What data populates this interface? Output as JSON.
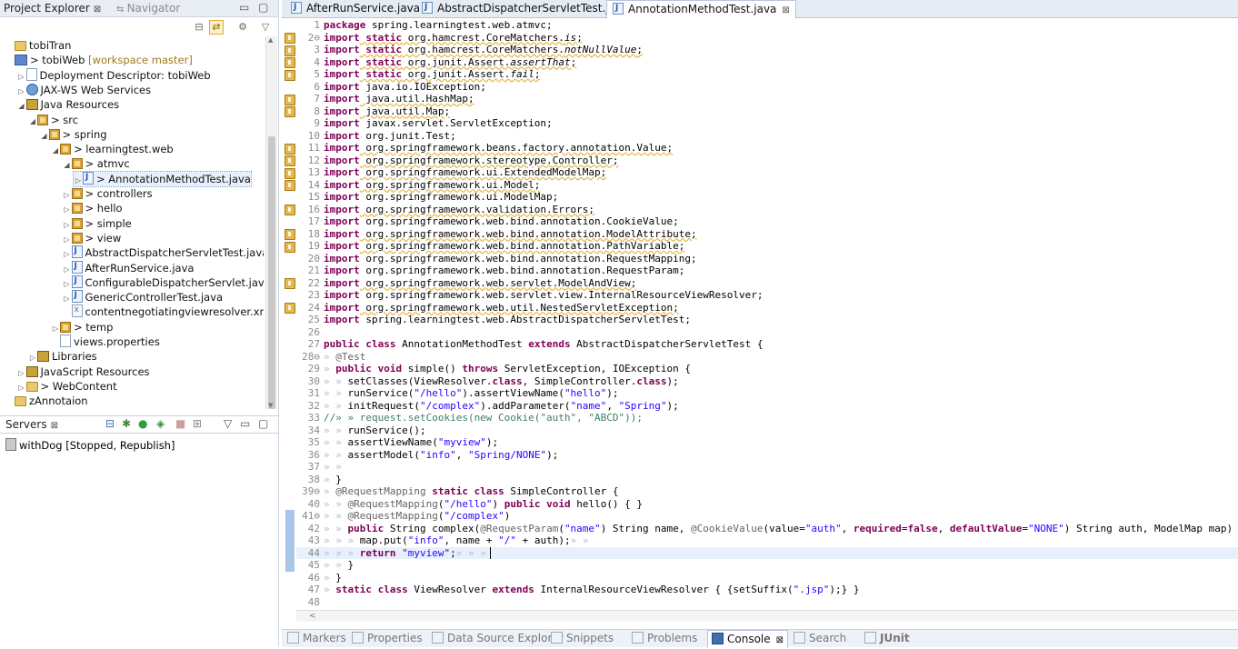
{
  "project_explorer": {
    "tabs": [
      {
        "label": "Project Explorer",
        "close": "⊠",
        "icon": "project-explorer-icon"
      },
      {
        "label": "Navigator",
        "icon": "navigator-icon"
      }
    ],
    "tree": [
      {
        "label": "tobiTran",
        "extra": "",
        "indent": 0,
        "arrow": "",
        "icon": "folder"
      },
      {
        "label": "> tobiWeb",
        "extra": " [workspace master]",
        "indent": 0,
        "arrow": "",
        "icon": "proj"
      },
      {
        "label": "Deployment Descriptor: tobiWeb",
        "extra": "",
        "indent": 1,
        "arrow": "▷",
        "icon": "props"
      },
      {
        "label": "JAX-WS Web Services",
        "extra": "",
        "indent": 1,
        "arrow": "▷",
        "icon": "web"
      },
      {
        "label": "Java Resources",
        "extra": "",
        "indent": 1,
        "arrow": "◢",
        "icon": "lib"
      },
      {
        "label": "> src",
        "extra": "",
        "indent": 2,
        "arrow": "◢",
        "icon": "pkg"
      },
      {
        "label": "> spring",
        "extra": "",
        "indent": 3,
        "arrow": "◢",
        "icon": "pkg"
      },
      {
        "label": "> learningtest.web",
        "extra": "",
        "indent": 4,
        "arrow": "◢",
        "icon": "pkg"
      },
      {
        "label": "> atmvc",
        "extra": "",
        "indent": 5,
        "arrow": "◢",
        "icon": "pkg"
      },
      {
        "label": "> AnnotationMethodTest.java",
        "extra": "",
        "indent": 6,
        "arrow": "▷",
        "icon": "java",
        "selected": true
      },
      {
        "label": "> controllers",
        "extra": "",
        "indent": 5,
        "arrow": "▷",
        "icon": "pkg"
      },
      {
        "label": "> hello",
        "extra": "",
        "indent": 5,
        "arrow": "▷",
        "icon": "pkg"
      },
      {
        "label": "> simple",
        "extra": "",
        "indent": 5,
        "arrow": "▷",
        "icon": "pkg"
      },
      {
        "label": "> view",
        "extra": "",
        "indent": 5,
        "arrow": "▷",
        "icon": "pkg"
      },
      {
        "label": "AbstractDispatcherServletTest.java",
        "extra": "",
        "indent": 5,
        "arrow": "▷",
        "icon": "java"
      },
      {
        "label": "AfterRunService.java",
        "extra": "",
        "indent": 5,
        "arrow": "▷",
        "icon": "java"
      },
      {
        "label": "ConfigurableDispatcherServlet.java",
        "extra": "",
        "indent": 5,
        "arrow": "▷",
        "icon": "java"
      },
      {
        "label": "GenericControllerTest.java",
        "extra": "",
        "indent": 5,
        "arrow": "▷",
        "icon": "java"
      },
      {
        "label": "contentnegotiatingviewresolver.xml",
        "extra": "",
        "indent": 5,
        "arrow": "",
        "icon": "xml"
      },
      {
        "label": "> temp",
        "extra": "",
        "indent": 4,
        "arrow": "▷",
        "icon": "pkg"
      },
      {
        "label": "views.properties",
        "extra": "",
        "indent": 4,
        "arrow": "",
        "icon": "props"
      },
      {
        "label": "Libraries",
        "extra": "",
        "indent": 2,
        "arrow": "▷",
        "icon": "lib"
      },
      {
        "label": "JavaScript Resources",
        "extra": "",
        "indent": 1,
        "arrow": "▷",
        "icon": "lib"
      },
      {
        "label": "> WebContent",
        "extra": "",
        "indent": 1,
        "arrow": "▷",
        "icon": "folder"
      },
      {
        "label": "zAnnotaion",
        "extra": "",
        "indent": 0,
        "arrow": "",
        "icon": "folder"
      }
    ]
  },
  "servers": {
    "tab_label": "Servers",
    "close": "⊠",
    "items": [
      {
        "label": "withDog  [Stopped, Republish]"
      }
    ]
  },
  "editor": {
    "tabs": [
      {
        "label": "AfterRunService.java",
        "active": false
      },
      {
        "label": "AbstractDispatcherServletTest.java",
        "active": false
      },
      {
        "label": "AnnotationMethodTest.java",
        "active": true,
        "close": "⊠"
      }
    ],
    "warning_lines": [
      2,
      3,
      4,
      5,
      7,
      8,
      11,
      12,
      13,
      14,
      16,
      18,
      19,
      22,
      24
    ],
    "code": [
      [
        [
          "kw",
          "package"
        ],
        [
          "t",
          " spring.learningtest.web.atmvc;"
        ]
      ],
      [
        [
          "kw",
          "import"
        ],
        [
          "t",
          " "
        ],
        [
          "kw",
          "static"
        ],
        [
          "t",
          " org.hamcrest.CoreMatchers."
        ],
        [
          "it",
          "is"
        ],
        [
          "t",
          ";"
        ]
      ],
      [
        [
          "kw",
          "import"
        ],
        [
          "t",
          " "
        ],
        [
          "kw",
          "static"
        ],
        [
          "t",
          " org.hamcrest.CoreMatchers."
        ],
        [
          "it",
          "notNullValue"
        ],
        [
          "t",
          ";"
        ]
      ],
      [
        [
          "kw",
          "import"
        ],
        [
          "t",
          " "
        ],
        [
          "kw",
          "static"
        ],
        [
          "t",
          " org.junit.Assert."
        ],
        [
          "it",
          "assertThat"
        ],
        [
          "t",
          ";"
        ]
      ],
      [
        [
          "kw",
          "import"
        ],
        [
          "t",
          " "
        ],
        [
          "kw",
          "static"
        ],
        [
          "t",
          " org.junit.Assert."
        ],
        [
          "it",
          "fail"
        ],
        [
          "t",
          ";"
        ]
      ],
      [
        [
          "kw",
          "import"
        ],
        [
          "t",
          " java.io.IOException;"
        ]
      ],
      [
        [
          "kw",
          "import"
        ],
        [
          "t",
          " java.util.HashMap;"
        ]
      ],
      [
        [
          "kw",
          "import"
        ],
        [
          "t",
          " java.util.Map;"
        ]
      ],
      [
        [
          "kw",
          "import"
        ],
        [
          "t",
          " javax.servlet.ServletException;"
        ]
      ],
      [
        [
          "kw",
          "import"
        ],
        [
          "t",
          " org.junit.Test;"
        ]
      ],
      [
        [
          "kw",
          "import"
        ],
        [
          "t",
          " org.springframework.beans.factory.annotation.Value;"
        ]
      ],
      [
        [
          "kw",
          "import"
        ],
        [
          "t",
          " org.springframework.stereotype.Controller;"
        ]
      ],
      [
        [
          "kw",
          "import"
        ],
        [
          "t",
          " org.springframework.ui.ExtendedModelMap;"
        ]
      ],
      [
        [
          "kw",
          "import"
        ],
        [
          "t",
          " org.springframework.ui.Model;"
        ]
      ],
      [
        [
          "kw",
          "import"
        ],
        [
          "t",
          " org.springframework.ui.ModelMap;"
        ]
      ],
      [
        [
          "kw",
          "import"
        ],
        [
          "t",
          " org.springframework.validation.Errors;"
        ]
      ],
      [
        [
          "kw",
          "import"
        ],
        [
          "t",
          " org.springframework.web.bind.annotation.CookieValue;"
        ]
      ],
      [
        [
          "kw",
          "import"
        ],
        [
          "t",
          " org.springframework.web.bind.annotation.ModelAttribute;"
        ]
      ],
      [
        [
          "kw",
          "import"
        ],
        [
          "t",
          " org.springframework.web.bind.annotation.PathVariable;"
        ]
      ],
      [
        [
          "kw",
          "import"
        ],
        [
          "t",
          " org.springframework.web.bind.annotation.RequestMapping;"
        ]
      ],
      [
        [
          "kw",
          "import"
        ],
        [
          "t",
          " org.springframework.web.bind.annotation.RequestParam;"
        ]
      ],
      [
        [
          "kw",
          "import"
        ],
        [
          "t",
          " org.springframework.web.servlet.ModelAndView;"
        ]
      ],
      [
        [
          "kw",
          "import"
        ],
        [
          "t",
          " org.springframework.web.servlet.view.InternalResourceViewResolver;"
        ]
      ],
      [
        [
          "kw",
          "import"
        ],
        [
          "t",
          " org.springframework.web.util.NestedServletException;"
        ]
      ],
      [
        [
          "kw",
          "import"
        ],
        [
          "t",
          " spring.learningtest.web.AbstractDispatcherServletTest;"
        ]
      ],
      [
        [
          "t",
          ""
        ]
      ],
      [
        [
          "kw",
          "public"
        ],
        [
          "t",
          " "
        ],
        [
          "kw",
          "class"
        ],
        [
          "t",
          " AnnotationMethodTest "
        ],
        [
          "kw",
          "extends"
        ],
        [
          "t",
          " AbstractDispatcherServletTest {"
        ]
      ],
      [
        [
          "ws",
          "» "
        ],
        [
          "an",
          "@Test"
        ]
      ],
      [
        [
          "ws",
          "» "
        ],
        [
          "kw",
          "public"
        ],
        [
          "t",
          " "
        ],
        [
          "kw",
          "void"
        ],
        [
          "t",
          " simple() "
        ],
        [
          "kw",
          "throws"
        ],
        [
          "t",
          " ServletException, IOException {"
        ]
      ],
      [
        [
          "ws",
          "» » "
        ],
        [
          "t",
          "setClasses(ViewResolver."
        ],
        [
          "kw",
          "class"
        ],
        [
          "t",
          ", SimpleController."
        ],
        [
          "kw",
          "class"
        ],
        [
          "t",
          ");"
        ]
      ],
      [
        [
          "ws",
          "» » "
        ],
        [
          "t",
          "runService("
        ],
        [
          "st",
          "\"/hello\""
        ],
        [
          "t",
          ").assertViewName("
        ],
        [
          "st",
          "\"hello\""
        ],
        [
          "t",
          ");"
        ]
      ],
      [
        [
          "ws",
          "» » "
        ],
        [
          "t",
          "initRequest("
        ],
        [
          "st",
          "\"/complex\""
        ],
        [
          "t",
          ").addParameter("
        ],
        [
          "st",
          "\"name\""
        ],
        [
          "t",
          ", "
        ],
        [
          "st",
          "\"Spring\""
        ],
        [
          "t",
          ");"
        ]
      ],
      [
        [
          "cm",
          "//» » request.setCookies(new Cookie(\"auth\", \"ABCD\"));"
        ]
      ],
      [
        [
          "ws",
          "» » "
        ],
        [
          "t",
          "runService();"
        ]
      ],
      [
        [
          "ws",
          "» » "
        ],
        [
          "t",
          "assertViewName("
        ],
        [
          "st",
          "\"myview\""
        ],
        [
          "t",
          ");"
        ]
      ],
      [
        [
          "ws",
          "» » "
        ],
        [
          "t",
          "assertModel("
        ],
        [
          "st",
          "\"info\""
        ],
        [
          "t",
          ", "
        ],
        [
          "st",
          "\"Spring/NONE\""
        ],
        [
          "t",
          ");"
        ]
      ],
      [
        [
          "ws",
          "» »"
        ]
      ],
      [
        [
          "ws",
          "» "
        ],
        [
          "t",
          "}"
        ]
      ],
      [
        [
          "ws",
          "» "
        ],
        [
          "an",
          "@RequestMapping"
        ],
        [
          "t",
          " "
        ],
        [
          "kw",
          "static"
        ],
        [
          "t",
          " "
        ],
        [
          "kw",
          "class"
        ],
        [
          "t",
          " SimpleController {"
        ]
      ],
      [
        [
          "ws",
          "» » "
        ],
        [
          "an",
          "@RequestMapping"
        ],
        [
          "t",
          "("
        ],
        [
          "st",
          "\"/hello\""
        ],
        [
          "t",
          ") "
        ],
        [
          "kw",
          "public"
        ],
        [
          "t",
          " "
        ],
        [
          "kw",
          "void"
        ],
        [
          "t",
          " hello() { }"
        ]
      ],
      [
        [
          "ws",
          "» » "
        ],
        [
          "an",
          "@RequestMapping"
        ],
        [
          "t",
          "("
        ],
        [
          "st",
          "\"/complex\""
        ],
        [
          "t",
          ")"
        ]
      ],
      [
        [
          "ws",
          "» » "
        ],
        [
          "kw",
          "public"
        ],
        [
          "t",
          " String complex("
        ],
        [
          "an",
          "@RequestParam"
        ],
        [
          "t",
          "("
        ],
        [
          "st",
          "\"name\""
        ],
        [
          "t",
          ") String name, "
        ],
        [
          "an",
          "@CookieValue"
        ],
        [
          "t",
          "(value="
        ],
        [
          "st",
          "\"auth\""
        ],
        [
          "t",
          ", "
        ],
        [
          "kw",
          "required"
        ],
        [
          "t",
          "="
        ],
        [
          "kw",
          "false"
        ],
        [
          "t",
          ", "
        ],
        [
          "kw",
          "defaultValue"
        ],
        [
          "t",
          "="
        ],
        [
          "st",
          "\"NONE\""
        ],
        [
          "t",
          ") String auth, ModelMap map) {"
        ]
      ],
      [
        [
          "ws",
          "» » » "
        ],
        [
          "t",
          "map.put("
        ],
        [
          "st",
          "\"info\""
        ],
        [
          "t",
          ", name + "
        ],
        [
          "st",
          "\"/\""
        ],
        [
          "t",
          " + auth);"
        ],
        [
          "ws",
          "» »"
        ]
      ],
      [
        [
          "ws",
          "» » » "
        ],
        [
          "kw",
          "return"
        ],
        [
          "t",
          " "
        ],
        [
          "st",
          "\"myview\""
        ],
        [
          "t",
          ";"
        ],
        [
          "ws",
          "» » »"
        ]
      ],
      [
        [
          "ws",
          "» » "
        ],
        [
          "t",
          "}"
        ]
      ],
      [
        [
          "ws",
          "» "
        ],
        [
          "t",
          "}"
        ]
      ],
      [
        [
          "ws",
          "» "
        ],
        [
          "kw",
          "static"
        ],
        [
          "t",
          " "
        ],
        [
          "kw",
          "class"
        ],
        [
          "t",
          " ViewResolver "
        ],
        [
          "kw",
          "extends"
        ],
        [
          "t",
          " InternalResourceViewResolver { {setSuffix("
        ],
        [
          "st",
          "\".jsp\""
        ],
        [
          "t",
          ");} }"
        ]
      ],
      [
        [
          "t",
          ""
        ]
      ]
    ],
    "fold_lines": {
      "2": "⊖",
      "28": "⊖",
      "39": "⊖",
      "41": "⊖"
    },
    "caret_line": 44,
    "hscroll_arrow": "<"
  },
  "bottom_tabs": [
    {
      "label": "Markers",
      "icon": "markers-icon",
      "active": false
    },
    {
      "label": "Properties",
      "icon": "properties-icon",
      "active": false
    },
    {
      "label": "Data Source Explorer",
      "icon": "data-source-icon",
      "active": false
    },
    {
      "label": "Snippets",
      "icon": "snippets-icon",
      "active": false
    },
    {
      "label": "Problems",
      "icon": "problems-icon",
      "active": false
    },
    {
      "label": "Console",
      "icon": "console-icon",
      "active": true,
      "close": "⊠"
    },
    {
      "label": "Search",
      "icon": "search-icon",
      "active": false
    },
    {
      "label": "JUnit",
      "icon": "junit-icon",
      "active": false
    }
  ]
}
